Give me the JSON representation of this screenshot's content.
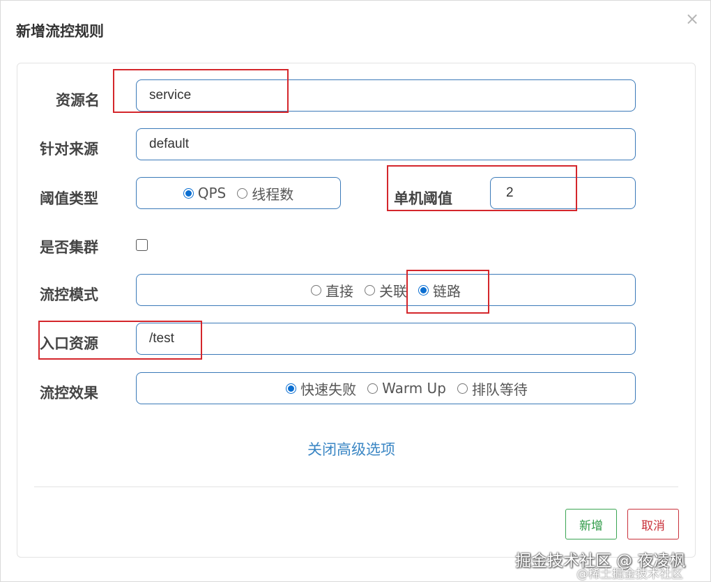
{
  "dialog": {
    "title": "新增流控规则",
    "close_glyph": "×"
  },
  "form": {
    "resource": {
      "label": "资源名",
      "value": "service"
    },
    "limit_app": {
      "label": "针对来源",
      "value": "default"
    },
    "threshold_type": {
      "label": "阈值类型",
      "options": [
        "QPS",
        "线程数"
      ],
      "selected": "QPS"
    },
    "threshold": {
      "label": "单机阈值",
      "value": "2"
    },
    "cluster": {
      "label": "是否集群",
      "checked": false
    },
    "strategy": {
      "label": "流控模式",
      "options": [
        "直接",
        "关联",
        "链路"
      ],
      "selected": "链路"
    },
    "ref_resource": {
      "label": "入口资源",
      "value": "/test"
    },
    "control_behavior": {
      "label": "流控效果",
      "options": [
        "快速失败",
        "Warm Up",
        "排队等待"
      ],
      "selected": "快速失败"
    }
  },
  "advanced_toggle": "关闭高级选项",
  "buttons": {
    "add": "新增",
    "cancel": "取消"
  },
  "watermark": {
    "line1": "掘金技术社区 @ 夜凌枫",
    "line2": "@稀土掘金技术社区"
  },
  "colors": {
    "primary": "#3a79b8",
    "link": "#3a86c4",
    "radio": "#0a6ed1",
    "add": "#2e9a47",
    "cancel": "#c9303a",
    "highlight": "#d4262b"
  }
}
